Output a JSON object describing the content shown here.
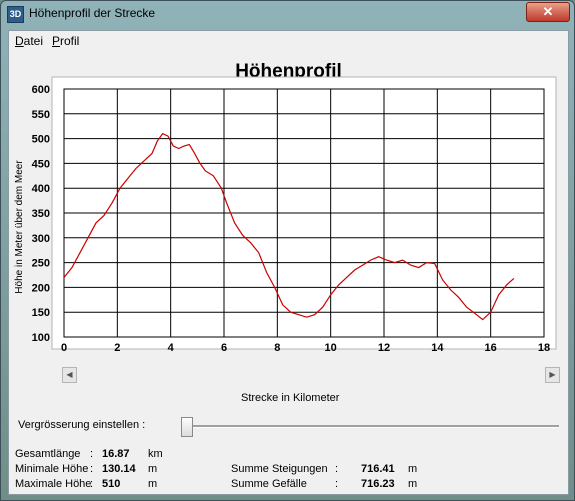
{
  "window": {
    "title": "Höhenprofil der Strecke",
    "icon": "3D",
    "close_symbol": "✕"
  },
  "menu": [
    {
      "label_u": "D",
      "label_rest": "atei"
    },
    {
      "label_u": "P",
      "label_rest": "rofil"
    }
  ],
  "chart_data": {
    "type": "line",
    "title": "Höhenprofil",
    "xlabel": "Strecke in Kilometer",
    "ylabel": "Höhe in Meter über dem Meer",
    "xlim": [
      0,
      18
    ],
    "ylim": [
      100,
      600
    ],
    "xticks": [
      "0",
      "2",
      "4",
      "6",
      "8",
      "10",
      "12",
      "14",
      "16",
      "18"
    ],
    "yticks": [
      "600",
      "550",
      "500",
      "450",
      "400",
      "350",
      "300",
      "250",
      "200",
      "150",
      "100"
    ],
    "grid": true,
    "series": [
      {
        "color": "#cc0000",
        "x": [
          0,
          0.3,
          0.6,
          0.9,
          1.2,
          1.5,
          1.8,
          2.1,
          2.4,
          2.7,
          3.0,
          3.3,
          3.5,
          3.7,
          3.9,
          4.1,
          4.3,
          4.5,
          4.7,
          4.9,
          5.1,
          5.3,
          5.6,
          5.9,
          6.1,
          6.4,
          6.7,
          7.0,
          7.3,
          7.6,
          7.9,
          8.2,
          8.5,
          8.8,
          9.1,
          9.4,
          9.7,
          10.0,
          10.3,
          10.6,
          10.9,
          11.2,
          11.5,
          11.8,
          12.1,
          12.4,
          12.7,
          13.0,
          13.3,
          13.6,
          13.9,
          14.2,
          14.5,
          14.8,
          15.1,
          15.4,
          15.7,
          16.0,
          16.3,
          16.6,
          16.87
        ],
        "y": [
          220,
          240,
          270,
          300,
          330,
          345,
          370,
          400,
          420,
          440,
          455,
          470,
          495,
          510,
          505,
          485,
          480,
          485,
          488,
          470,
          450,
          435,
          425,
          400,
          370,
          330,
          305,
          290,
          270,
          230,
          200,
          165,
          150,
          145,
          140,
          145,
          160,
          185,
          205,
          220,
          235,
          245,
          255,
          262,
          255,
          250,
          255,
          245,
          240,
          250,
          248,
          215,
          195,
          180,
          160,
          148,
          135,
          150,
          185,
          205,
          218
        ]
      }
    ]
  },
  "slider": {
    "label": "Vergrösserung einstellen :"
  },
  "stats_left": [
    {
      "label": "Gesamtlänge",
      "colon": ":",
      "value": "16.87",
      "unit": "km"
    },
    {
      "label": "Minimale Höhe",
      "colon": ":",
      "value": "130.14",
      "unit": "m"
    },
    {
      "label": "Maximale Höhe",
      "colon": ":",
      "value": "510",
      "unit": "m"
    }
  ],
  "stats_right": [
    {
      "label": "Summe Steigungen",
      "colon": ":",
      "value": "716.41",
      "unit": "m"
    },
    {
      "label": "Summe Gefälle",
      "colon": ":",
      "value": "716.23",
      "unit": "m"
    }
  ],
  "colors": {
    "line": "#cc0000"
  }
}
